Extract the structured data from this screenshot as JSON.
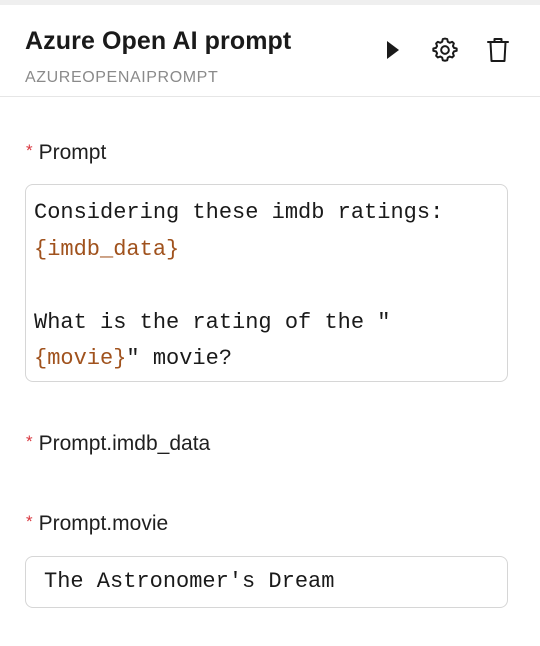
{
  "header": {
    "title": "Azure Open AI prompt",
    "subtitle": "AZUREOPENAIPROMPT",
    "icons": [
      "play-icon",
      "gear-icon",
      "trash-icon"
    ]
  },
  "fields": {
    "prompt": {
      "required_mark": "*",
      "label": "Prompt",
      "lines": {
        "line1": "Considering these imdb ratings:",
        "line2_var": "{imdb_data}",
        "line3": "",
        "line4": "What is the rating of the \"",
        "line5_var": "{movie}",
        "line5_rest": "\" movie?"
      }
    },
    "imdb_data": {
      "required_mark": "*",
      "label": "Prompt.imdb_data"
    },
    "movie": {
      "required_mark": "*",
      "label": "Prompt.movie",
      "value": "The Astronomer's Dream"
    }
  },
  "colors": {
    "variable": "#a0521d",
    "required": "#d9363e",
    "subtitle": "#8a8a8a",
    "border": "#d6d6d6"
  }
}
